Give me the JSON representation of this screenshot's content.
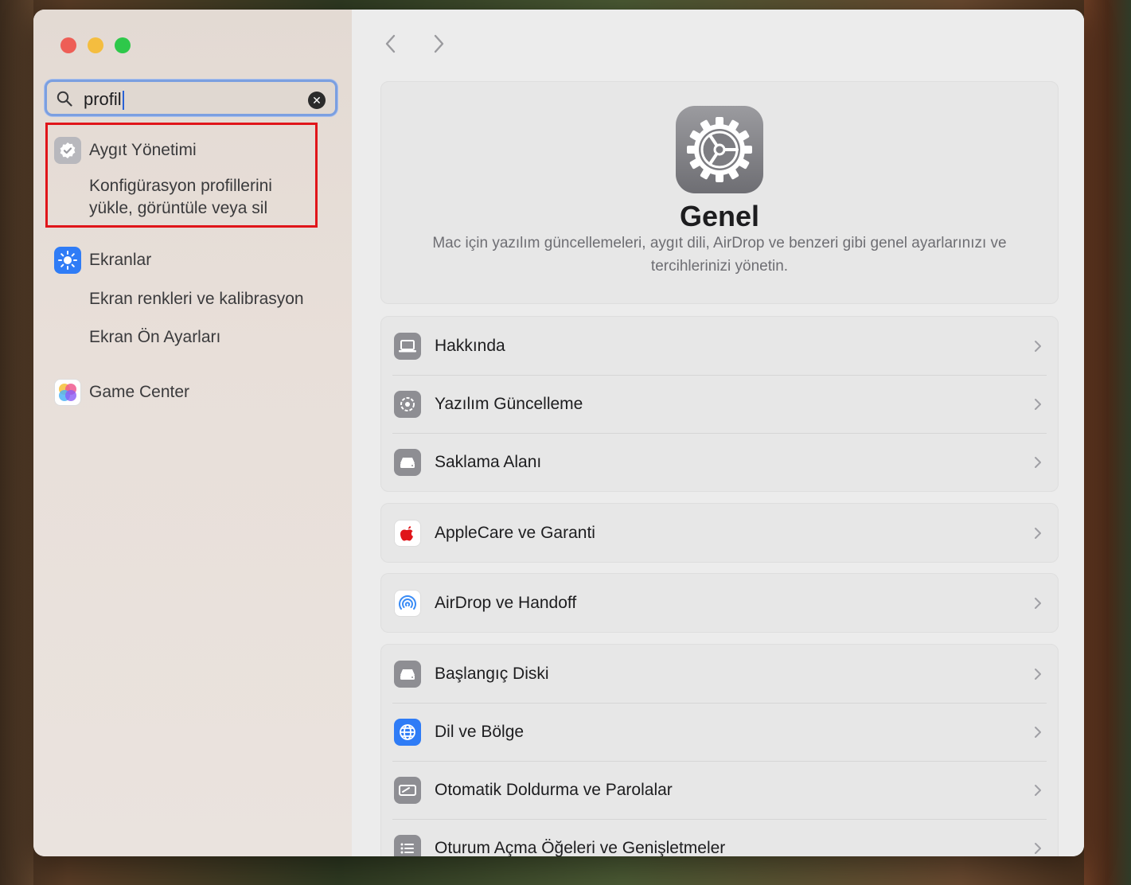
{
  "window": {
    "search": {
      "value": "profil"
    },
    "sidebar": {
      "results": [
        {
          "label": "Aygıt Yönetimi",
          "icon": "checkmark-badge-icon",
          "color": "#b8b8bd",
          "sub": [
            "Konfigürasyon profillerini",
            "yükle, görüntüle veya sil"
          ]
        },
        {
          "label": "Ekranlar",
          "icon": "sun-icon",
          "color": "#2f7cf6",
          "sub": [
            "Ekran renkleri ve kalibrasyon",
            "Ekran Ön Ayarları"
          ]
        },
        {
          "label": "Game Center",
          "icon": "game-center-icon",
          "color": "#ffffff",
          "sub": []
        }
      ]
    },
    "content": {
      "title": "Genel",
      "description_line1": "Mac için yazılım güncellemeleri, aygıt dili, AirDrop ve benzeri gibi genel ayarlarınızı ve",
      "description_line2": "tercihlerinizi yönetin.",
      "groups": [
        [
          {
            "label": "Hakkında",
            "icon": "laptop-icon"
          },
          {
            "label": "Yazılım Güncelleme",
            "icon": "gear-update-icon"
          },
          {
            "label": "Saklama Alanı",
            "icon": "drive-icon"
          }
        ],
        [
          {
            "label": "AppleCare ve Garanti",
            "icon": "apple-icon"
          }
        ],
        [
          {
            "label": "AirDrop ve Handoff",
            "icon": "airdrop-icon"
          }
        ],
        [
          {
            "label": "Başlangıç Diski",
            "icon": "drive-icon"
          },
          {
            "label": "Dil ve Bölge",
            "icon": "globe-icon"
          },
          {
            "label": "Otomatik Doldurma ve Parolalar",
            "icon": "autofill-icon"
          },
          {
            "label": "Oturum Açma Öğeleri ve Genişletmeler",
            "icon": "list-icon"
          }
        ]
      ]
    }
  },
  "colors": {
    "accent": "#2f7cf6",
    "highlight": "#e0151a"
  }
}
